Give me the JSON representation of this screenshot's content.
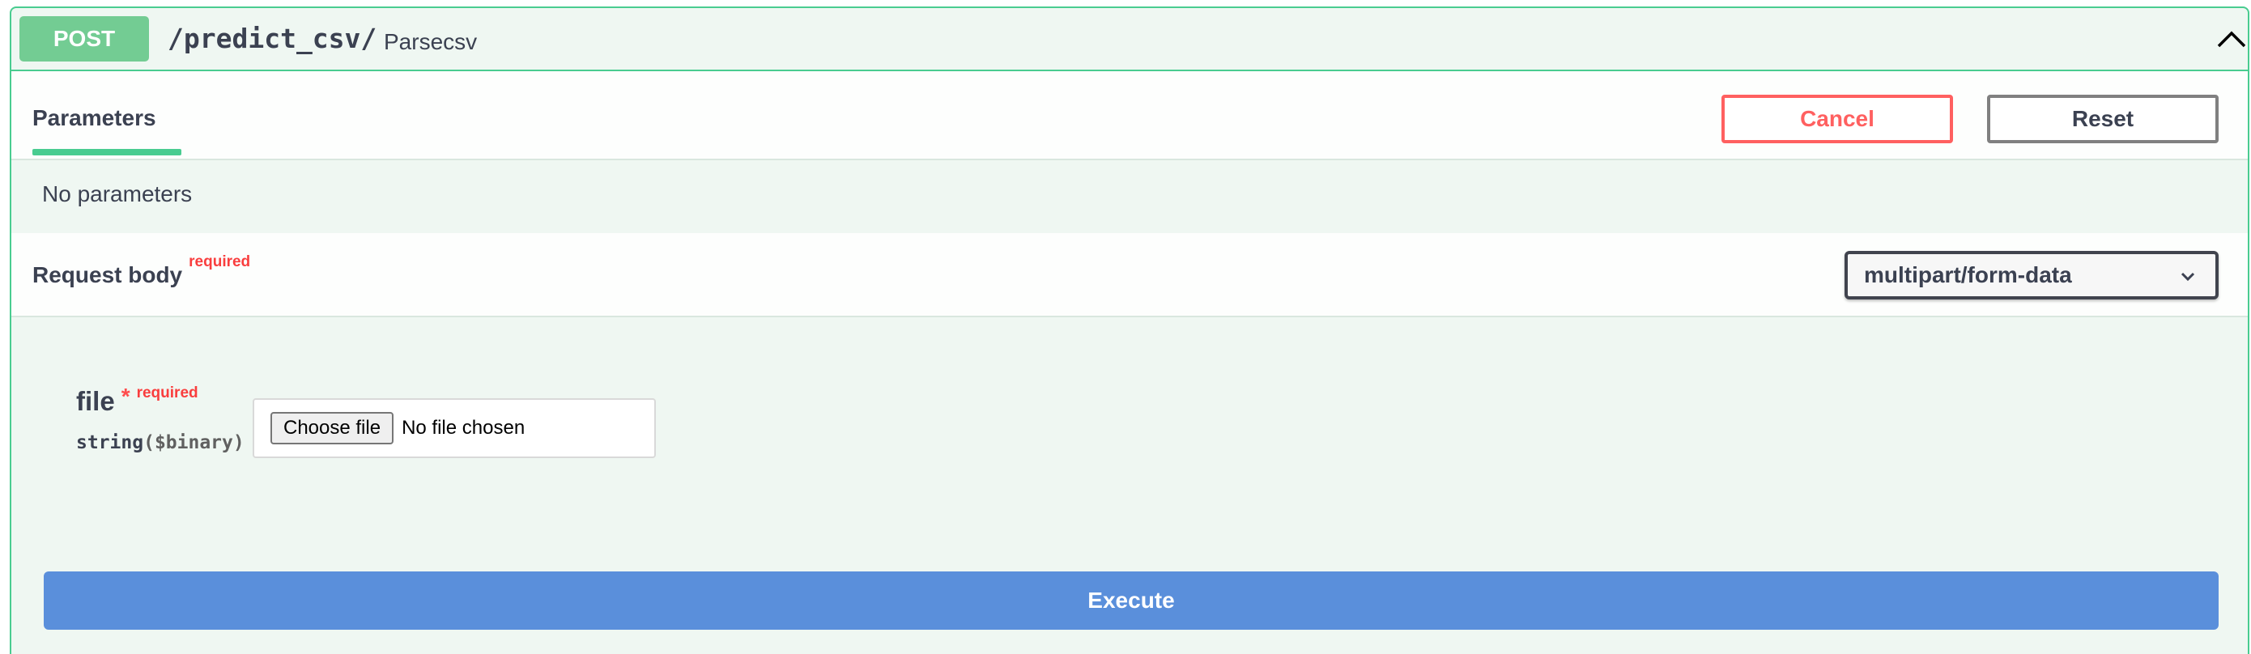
{
  "summary": {
    "method": "POST",
    "path": "/predict_csv/",
    "description": "Parsecsv",
    "collapse_icon": "chevron-up-icon"
  },
  "parameters": {
    "tab_label": "Parameters",
    "cancel_label": "Cancel",
    "reset_label": "Reset",
    "empty_text": "No parameters"
  },
  "request_body": {
    "title": "Request body",
    "required_label": "required",
    "content_type": "multipart/form-data",
    "dropdown_icon": "chevron-down-icon"
  },
  "file_param": {
    "name": "file",
    "asterisk": "*",
    "required_label": "required",
    "type": "string",
    "format": "($binary)",
    "choose_button": "Choose file",
    "no_file_text": "No file chosen"
  },
  "execute_label": "Execute",
  "colors": {
    "post_badge": "#73cc93",
    "post_border": "#49cc90",
    "panel_bg": "#eff7f2",
    "cancel": "#ff6060",
    "required": "#f93e3e",
    "execute": "#5a8fdb"
  }
}
